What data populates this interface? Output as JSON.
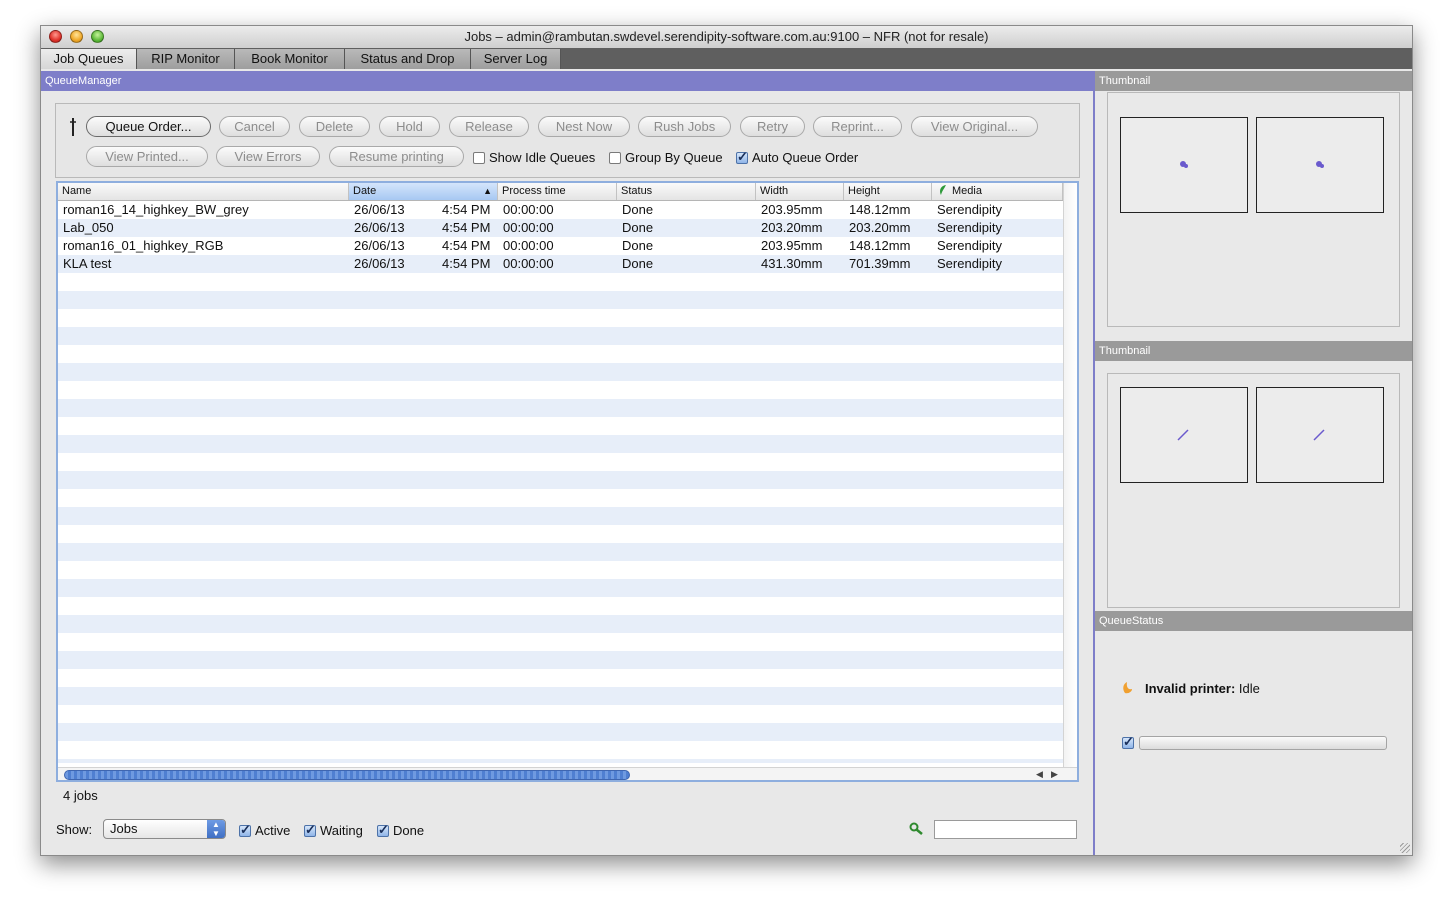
{
  "window": {
    "title": "Jobs – admin@rambutan.swdevel.serendipity-software.com.au:9100 – NFR (not for resale)"
  },
  "tabs": [
    {
      "label": "Job Queues",
      "active": true
    },
    {
      "label": "RIP Monitor",
      "active": false
    },
    {
      "label": "Book Monitor",
      "active": false
    },
    {
      "label": "Status and Drop",
      "active": false
    },
    {
      "label": "Server Log",
      "active": false
    }
  ],
  "queue_manager": {
    "header": "QueueManager",
    "buttons": {
      "queue_order": "Queue Order...",
      "cancel": "Cancel",
      "delete": "Delete",
      "hold": "Hold",
      "release": "Release",
      "nest_now": "Nest Now",
      "rush_jobs": "Rush Jobs",
      "retry": "Retry",
      "reprint": "Reprint...",
      "view_original": "View Original...",
      "view_printed": "View Printed...",
      "view_errors": "View Errors",
      "resume_printing": "Resume printing"
    },
    "checkboxes": {
      "show_idle_queues": {
        "label": "Show Idle Queues",
        "checked": false
      },
      "group_by_queue": {
        "label": "Group By Queue",
        "checked": false
      },
      "auto_queue_order": {
        "label": "Auto Queue Order",
        "checked": true
      }
    },
    "table": {
      "columns": [
        "Name",
        "Date",
        "Process time",
        "Status",
        "Width",
        "Height",
        "Media"
      ],
      "sorted_column": "Date",
      "rows": [
        {
          "name": "roman16_14_highkey_BW_grey",
          "date": "26/06/13",
          "time": "4:54 PM",
          "process": "00:00:00",
          "status": "Done",
          "width": "203.95mm",
          "height": "148.12mm",
          "media": "Serendipity"
        },
        {
          "name": "Lab_050",
          "date": "26/06/13",
          "time": "4:54 PM",
          "process": "00:00:00",
          "status": "Done",
          "width": "203.20mm",
          "height": "203.20mm",
          "media": "Serendipity"
        },
        {
          "name": "roman16_01_highkey_RGB",
          "date": "26/06/13",
          "time": "4:54 PM",
          "process": "00:00:00",
          "status": "Done",
          "width": "203.95mm",
          "height": "148.12mm",
          "media": "Serendipity"
        },
        {
          "name": "KLA test",
          "date": "26/06/13",
          "time": "4:54 PM",
          "process": "00:00:00",
          "status": "Done",
          "width": "431.30mm",
          "height": "701.39mm",
          "media": "Serendipity"
        }
      ]
    },
    "job_count": "4 jobs",
    "show_filter": {
      "label": "Show:",
      "selected": "Jobs",
      "active": {
        "label": "Active",
        "checked": true
      },
      "waiting": {
        "label": "Waiting",
        "checked": true
      },
      "done": {
        "label": "Done",
        "checked": true
      }
    }
  },
  "side": {
    "thumbnail1_header": "Thumbnail",
    "thumbnail2_header": "Thumbnail",
    "queue_status_header": "QueueStatus",
    "printer_label": "Invalid printer:",
    "printer_state": "Idle"
  },
  "colors": {
    "accent": "#7e7ec9",
    "thumb_mark": "#6a5acd",
    "status_icon": "#f0a030",
    "media_icon": "#2e9a3a"
  }
}
